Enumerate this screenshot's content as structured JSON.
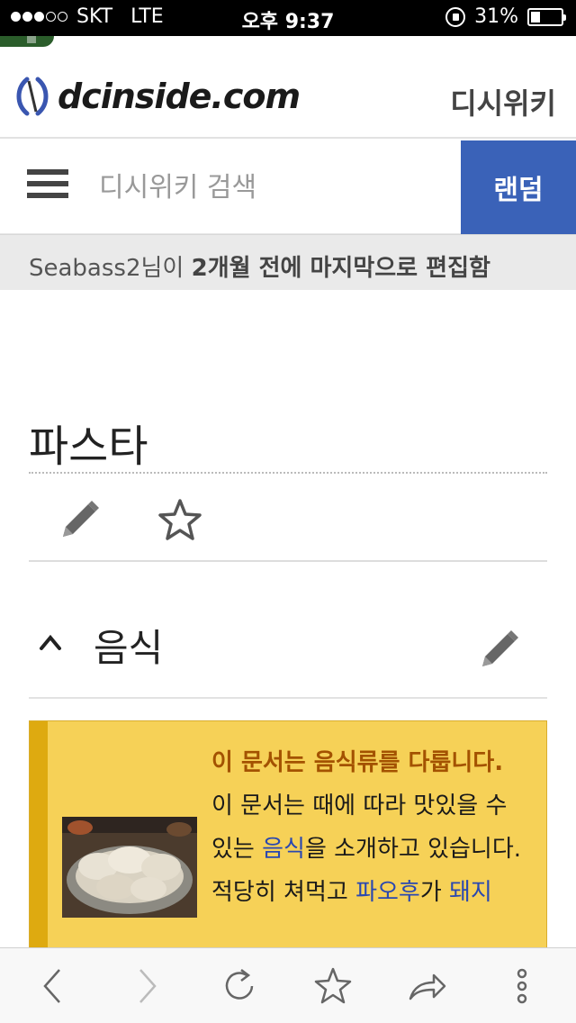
{
  "status_bar": {
    "carrier": "SKT",
    "network": "LTE",
    "time": "오후 9:37",
    "battery": "31%",
    "signal_bars": 3,
    "battery_level": 0.31
  },
  "header": {
    "logo_text": "dcinside.com",
    "wiki_label": "디시위키"
  },
  "search": {
    "placeholder": "디시위키 검색",
    "random_label": "랜덤"
  },
  "last_edit": {
    "user": "Seabass2",
    "suffix": "님이 ",
    "bold": "2개월 전에 마지막으로 편집함"
  },
  "page": {
    "title": "파스타"
  },
  "section": {
    "title": "음식"
  },
  "infobox": {
    "heading": "이 문서는 음식류를 다룹니다.",
    "line1_a": "이 문서는 때에 따라 맛있을 수 있는 ",
    "line1_link": "음식",
    "line1_b": "을 소개하고 있습니다.",
    "line2_a": "적당히 쳐먹고 ",
    "line2_link1": "파오후",
    "line2_b": "가 ",
    "line2_link2": "돼지"
  },
  "colors": {
    "accent": "#3a62b8",
    "infobox_bg": "#f6d157",
    "infobox_bar": "#deaa10",
    "heading": "#a35200",
    "link": "#2a48b0"
  },
  "icons": {
    "menu": "hamburger-icon",
    "edit": "pencil-icon",
    "watch": "star-icon",
    "collapse": "chevron-up-icon",
    "back": "chevron-left-icon",
    "forward": "chevron-right-icon",
    "reload": "reload-icon",
    "bookmark": "star-icon",
    "share": "share-icon",
    "more": "more-icon"
  }
}
